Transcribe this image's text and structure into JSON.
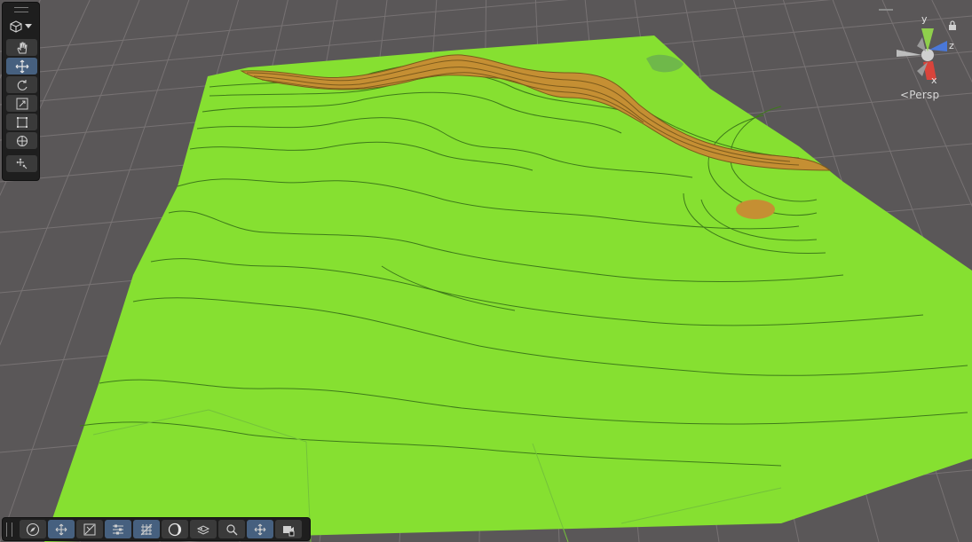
{
  "window": {
    "view_mode_label": "Persp"
  },
  "gizmo_axes": {
    "y": "y",
    "z": "z",
    "x": "x"
  },
  "colors": {
    "background": "#5a5758",
    "grid": "#777273",
    "terrain": "#86e031",
    "contour": "#3e7a1a",
    "path_fill": "#c58f33",
    "path_stroke": "#7c5a1c",
    "toolbar_bg": "#1e1e1e",
    "button_active": "#46607f",
    "axis_x": "#d9443b",
    "axis_y": "#8fcf4c",
    "axis_z": "#4a78d8"
  },
  "tools": [
    {
      "id": "view",
      "icon": "hand-icon",
      "active": false
    },
    {
      "id": "move",
      "icon": "move-arrows-icon",
      "active": true
    },
    {
      "id": "rotate",
      "icon": "rotate-icon",
      "active": false
    },
    {
      "id": "scale",
      "icon": "scale-icon",
      "active": false
    },
    {
      "id": "rect",
      "icon": "rect-transform-icon",
      "active": false
    },
    {
      "id": "transform",
      "icon": "transform-icon",
      "active": false
    },
    {
      "id": "custom",
      "icon": "custom-tool-icon",
      "active": false
    }
  ],
  "overlay_buttons": [
    {
      "icon": "compass-icon",
      "active": false
    },
    {
      "icon": "move-icon",
      "active": true
    },
    {
      "icon": "snap-icon",
      "active": false
    },
    {
      "icon": "sliders-icon",
      "active": true
    },
    {
      "icon": "grid-icon",
      "active": true
    },
    {
      "icon": "shading-icon",
      "active": false
    },
    {
      "icon": "layers-icon",
      "active": false
    },
    {
      "icon": "search-icon",
      "active": false
    },
    {
      "icon": "arrows-icon",
      "active": true
    },
    {
      "icon": "camera-icon",
      "active": false
    }
  ]
}
